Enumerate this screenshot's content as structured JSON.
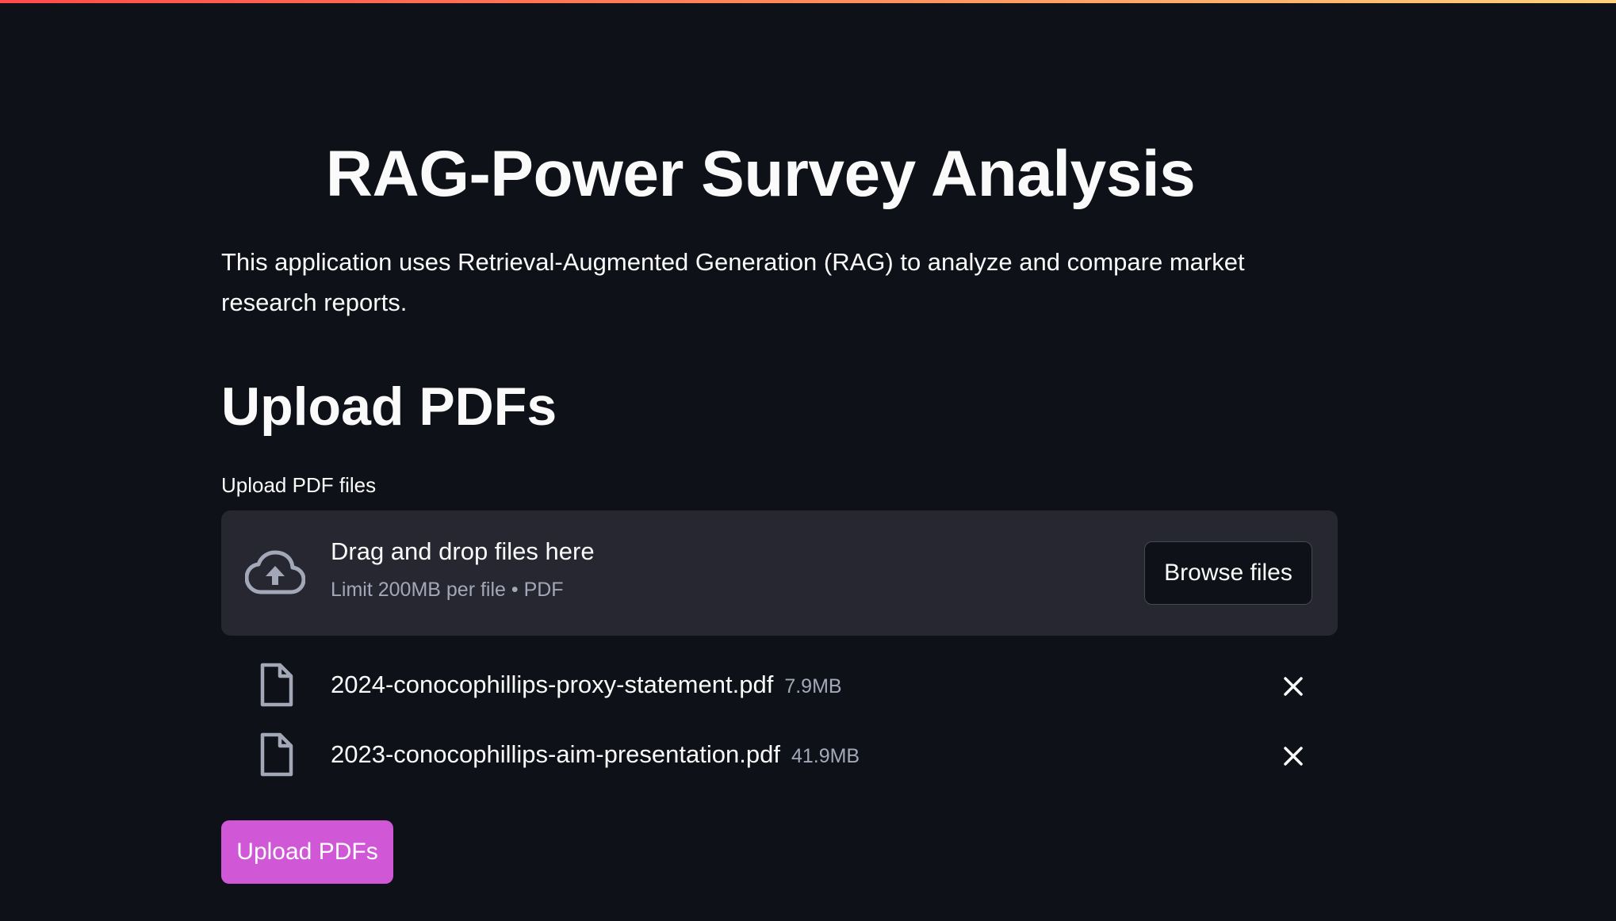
{
  "header": {
    "title": "RAG-Power Survey Analysis",
    "description": "This application uses Retrieval-Augmented Generation (RAG) to analyze and compare market research reports."
  },
  "upload_section": {
    "heading": "Upload PDFs",
    "uploader_label": "Upload PDF files",
    "dropzone": {
      "primary_text": "Drag and drop files here",
      "secondary_text": "Limit 200MB per file • PDF",
      "icon": "cloud-upload-icon"
    },
    "browse_button_label": "Browse files",
    "files": [
      {
        "name": "2024-conocophillips-proxy-statement.pdf",
        "size": "7.9MB",
        "icon": "file-icon"
      },
      {
        "name": "2023-conocophillips-aim-presentation.pdf",
        "size": "41.9MB",
        "icon": "file-icon"
      }
    ],
    "upload_button_label": "Upload PDFs"
  },
  "colors": {
    "background": "#0e1117",
    "panel": "#262730",
    "accent": "#d057d6",
    "muted_text": "#a3a8b8"
  }
}
